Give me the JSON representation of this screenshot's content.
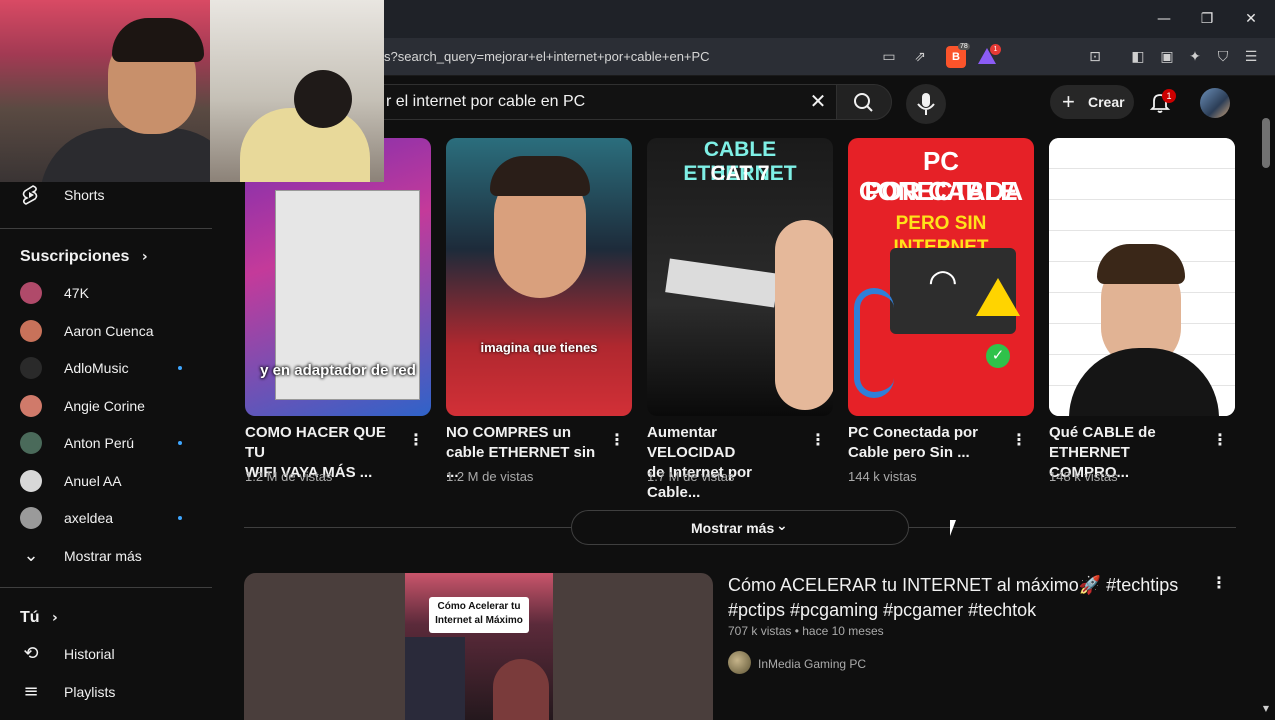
{
  "browser": {
    "url": "s?search_query=mejorar+el+internet+por+cable+en+PC",
    "brave_badge": "78",
    "rewards_badge": "1"
  },
  "header": {
    "search_value": "r el internet por cable en PC",
    "create_label": "Crear",
    "notifications_count": "1"
  },
  "sidebar": {
    "shorts_label": "Shorts",
    "subscriptions_title": "Suscripciones",
    "subscriptions": [
      {
        "name": "47K",
        "live": false,
        "color": "#b04a6a"
      },
      {
        "name": "Aaron Cuenca",
        "live": false,
        "color": "#c8725a"
      },
      {
        "name": "AdloMusic",
        "live": true,
        "color": "#2a2a2a"
      },
      {
        "name": "Angie Corine",
        "live": false,
        "color": "#d07a6a"
      },
      {
        "name": "Anton Perú",
        "live": true,
        "color": "#4a6a5a"
      },
      {
        "name": "Anuel AA",
        "live": false,
        "color": "#d8d8d8"
      },
      {
        "name": "axeldea",
        "live": true,
        "color": "#9a9a9a"
      }
    ],
    "show_more_label": "Mostrar más",
    "you_title": "Tú",
    "history_label": "Historial",
    "playlists_label": "Playlists"
  },
  "shorts": [
    {
      "title_line1": "COMO HACER QUE TU",
      "title_line2": "WIFI VAYA MÁS ...",
      "views": "1.2 M de vistas",
      "caption": "y en adaptador de red"
    },
    {
      "title_line1": "NO COMPRES un",
      "title_line2": "cable ETHERNET sin ...",
      "views": "1.2 M de vistas",
      "caption": "imagina que tienes"
    },
    {
      "title_line1": "Aumentar VELOCIDAD",
      "title_line2": "de Internet por Cable...",
      "views": "1.7 M de vistas",
      "caption_line1": "CABLE ETHERNET",
      "caption_line2": "CAT 7"
    },
    {
      "title_line1": "PC Conectada por",
      "title_line2": "Cable pero Sin ...",
      "views": "144 k vistas",
      "caption_line1": "PC CONECTADA",
      "caption_line2": "POR CABLE",
      "caption_line3": "PERO SIN INTERNET"
    },
    {
      "title_line1": "Qué CABLE de",
      "title_line2": "ETHERNET COMPRO...",
      "views": "148 k vistas"
    }
  ],
  "show_more_button": "Mostrar más",
  "video": {
    "title_line1": "Cómo ACELERAR tu INTERNET al máximo🚀 #techtips",
    "title_line2": "#pctips #pcgaming #pcgamer #techtok",
    "meta": "707 k vistas • hace 10 meses",
    "channel": "InMedia Gaming PC",
    "thumb_caption_line1": "Cómo Acelerar tu",
    "thumb_caption_line2": "Internet al Máximo"
  },
  "colors": {
    "background": "#0f0f0f",
    "accent_red": "#cc0000",
    "live_dot": "#3ea6ff"
  }
}
